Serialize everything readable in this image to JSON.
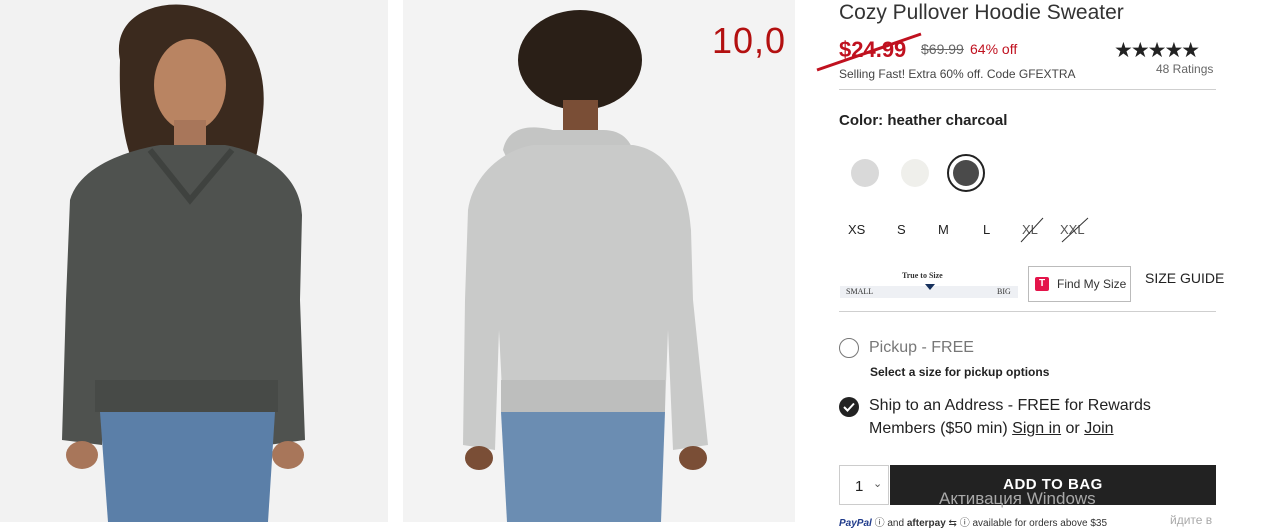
{
  "product": {
    "title": "Cozy Pullover Hoodie Sweater",
    "sale_price": "$24.99",
    "original_price": "$69.99",
    "discount": "64% off",
    "promo": "Selling Fast! Extra 60% off. Code GFEXTRA",
    "stars": "★★★★★",
    "rating_value": 5,
    "ratings_count": "48 Ratings"
  },
  "annotation": {
    "price_note": "10,0"
  },
  "color": {
    "label": "Color: heather charcoal",
    "swatches": [
      {
        "name": "light grey",
        "color": "#d9d9d9",
        "selected": false
      },
      {
        "name": "ivory",
        "color": "#efefeb",
        "selected": false
      },
      {
        "name": "heather charcoal",
        "color": "#4a4a4a",
        "selected": true
      }
    ]
  },
  "sizes": [
    {
      "label": "XS",
      "available": true
    },
    {
      "label": "S",
      "available": true
    },
    {
      "label": "M",
      "available": true
    },
    {
      "label": "L",
      "available": true
    },
    {
      "label": "XL",
      "available": false
    },
    {
      "label": "XXL",
      "available": false
    }
  ],
  "fit": {
    "title": "True to Size",
    "small": "SMALL",
    "big": "BIG"
  },
  "find_my_size": {
    "icon_letter": "T",
    "label": "Find My Size"
  },
  "size_guide": "SIZE GUIDE",
  "fulfillment": {
    "pickup_label": "Pickup - FREE",
    "pickup_sub": "Select a size for pickup options",
    "ship_label_1": "Ship to an Address - FREE for Rewards",
    "ship_label_2": "Members ($50 min)",
    "sign_in": "Sign in",
    "or": "or",
    "join": "Join"
  },
  "cart": {
    "quantity": "1",
    "add_label": "ADD TO BAG"
  },
  "payment": {
    "paypal": "PayPal",
    "text_and": "and",
    "afterpay": "afterpay",
    "text": "available for orders above $35"
  },
  "watermark": {
    "line1": "Активация Windows",
    "line2": "йдите в"
  },
  "colors": {
    "sale_red": "#c0111f",
    "note_red": "#b31010",
    "button_dark": "#222222",
    "brand_pink": "#e4144a"
  }
}
